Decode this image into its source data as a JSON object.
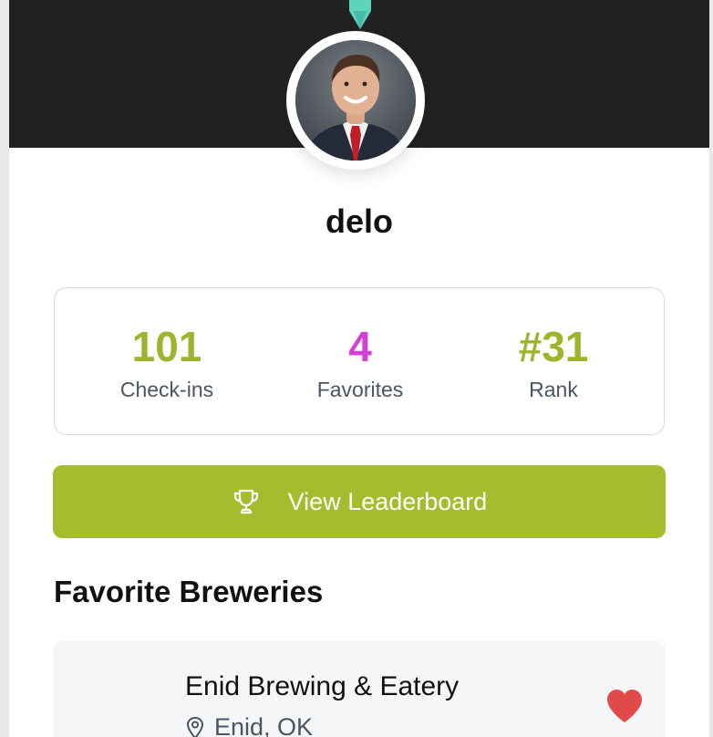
{
  "profile": {
    "username": "delo"
  },
  "stats": {
    "checkins": {
      "value": "101",
      "label": "Check-ins",
      "color": "#9cb52c"
    },
    "favorites": {
      "value": "4",
      "label": "Favorites",
      "color": "#d63fd4"
    },
    "rank": {
      "value": "#31",
      "label": "Rank",
      "color": "#9cb52c"
    }
  },
  "leaderboard_button": {
    "label": "View Leaderboard",
    "icon": "trophy-icon",
    "color": "#a4bc2e"
  },
  "favorites_section": {
    "title": "Favorite Breweries",
    "items": [
      {
        "name": "Enid Brewing & Eatery",
        "location": "Enid, OK",
        "favorited": true
      }
    ]
  },
  "colors": {
    "header": "#222222",
    "accent": "#a4bc2e",
    "heart": "#e04a4a",
    "ornament": "#5ed3bd"
  }
}
